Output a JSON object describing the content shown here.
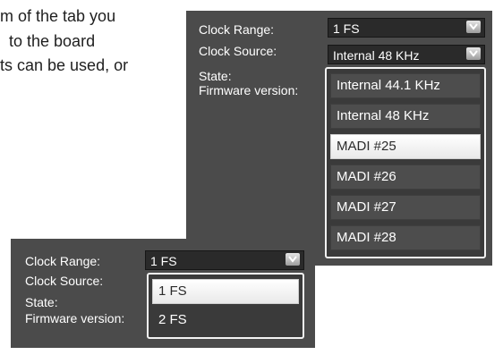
{
  "doc": {
    "lines": [
      "m of the tab you",
      "to the board",
      "ts can be used, or"
    ]
  },
  "panel_top": {
    "clock_range_label": "Clock Range:",
    "clock_range_value": "1 FS",
    "clock_source_label": "Clock Source:",
    "clock_source_value": "Internal 48 KHz",
    "state_label": "State:",
    "firmware_label": "Firmware version:",
    "options": [
      "Internal 44.1 KHz",
      "Internal 48 KHz",
      "MADI #25",
      "MADI #26",
      "MADI #27",
      "MADI #28"
    ],
    "selected_option": "MADI #25"
  },
  "panel_bottom": {
    "clock_range_label": "Clock Range:",
    "clock_range_value": "1 FS",
    "clock_source_label": "Clock Source:",
    "state_label": "State:",
    "firmware_label": "Firmware version:",
    "options": [
      "1 FS",
      "2 FS"
    ],
    "selected_option": "1 FS"
  },
  "icons": {
    "dropdown_arrow": "chevron-down-icon"
  },
  "colors": {
    "panel_bg": "#4b4b4b",
    "combo_bg": "#2a2a2a",
    "option_bg": "#4d4d4d",
    "selected_bg": "#ffffff"
  }
}
